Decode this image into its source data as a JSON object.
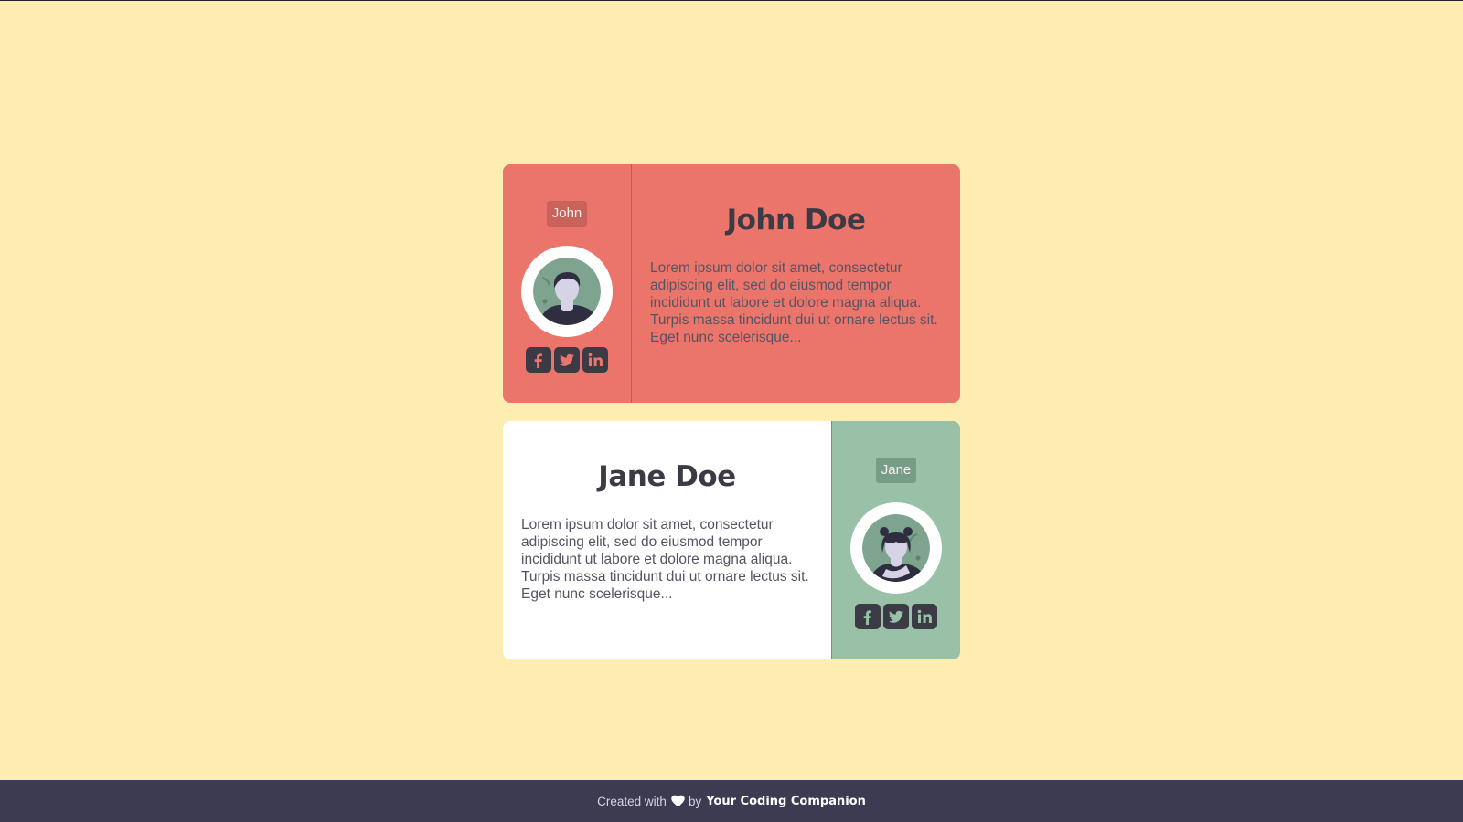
{
  "cards": [
    {
      "tag": "John",
      "name": "John Doe",
      "description": "Lorem ipsum dolor sit amet, consectetur adipiscing elit, sed do eiusmod tempor incididunt ut labore et dolore magna aliqua. Turpis massa tincidunt dui ut ornare lectus sit. Eget nunc scelerisque...",
      "socials": [
        "facebook-icon",
        "twitter-icon",
        "linkedin-icon"
      ]
    },
    {
      "tag": "Jane",
      "name": "Jane Doe",
      "description": "Lorem ipsum dolor sit amet, consectetur adipiscing elit, sed do eiusmod tempor incididunt ut labore et dolore magna aliqua. Turpis massa tincidunt dui ut ornare lectus sit. Eget nunc scelerisque...",
      "socials": [
        "facebook-icon",
        "twitter-icon",
        "linkedin-icon"
      ]
    }
  ],
  "footer": {
    "prefix": "Created with",
    "by": "by",
    "author": "Your Coding Companion"
  },
  "colors": {
    "background": "#fdedb1",
    "john_card": "#ec756b",
    "jane_side": "#98c1a8",
    "footer": "#3c3b52",
    "text_dark": "#3b3a45"
  }
}
